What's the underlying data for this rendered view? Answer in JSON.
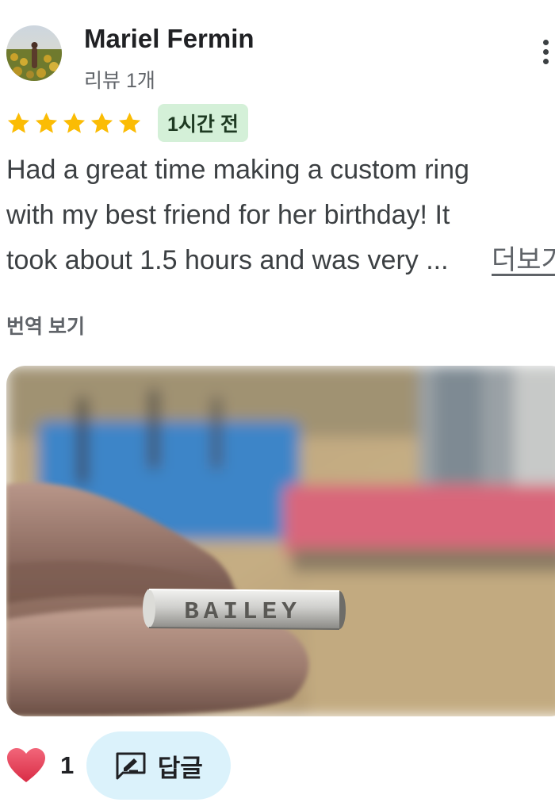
{
  "review": {
    "author": "Mariel Fermin",
    "review_count": "리뷰 1개",
    "rating": 5,
    "time_ago": "1시간 전",
    "text_lines": [
      "Had a great time making a custom ring",
      "with my best friend for her birthday! It",
      "took about 1.5 hours and was very ..."
    ],
    "more_label": "더보기",
    "translate_label": "번역 보기",
    "photo_icon": "ring-photo",
    "photo_ring_text": "BAILEY"
  },
  "actions": {
    "like_icon": "heart-icon",
    "like_count": "1",
    "reply_icon": "reply-edit-icon",
    "reply_label": "답글"
  },
  "colors": {
    "star": "#fbbc04",
    "badge_bg": "#d4f0d8",
    "reply_bg": "#dbf2fb",
    "heart": "#e8374f"
  }
}
